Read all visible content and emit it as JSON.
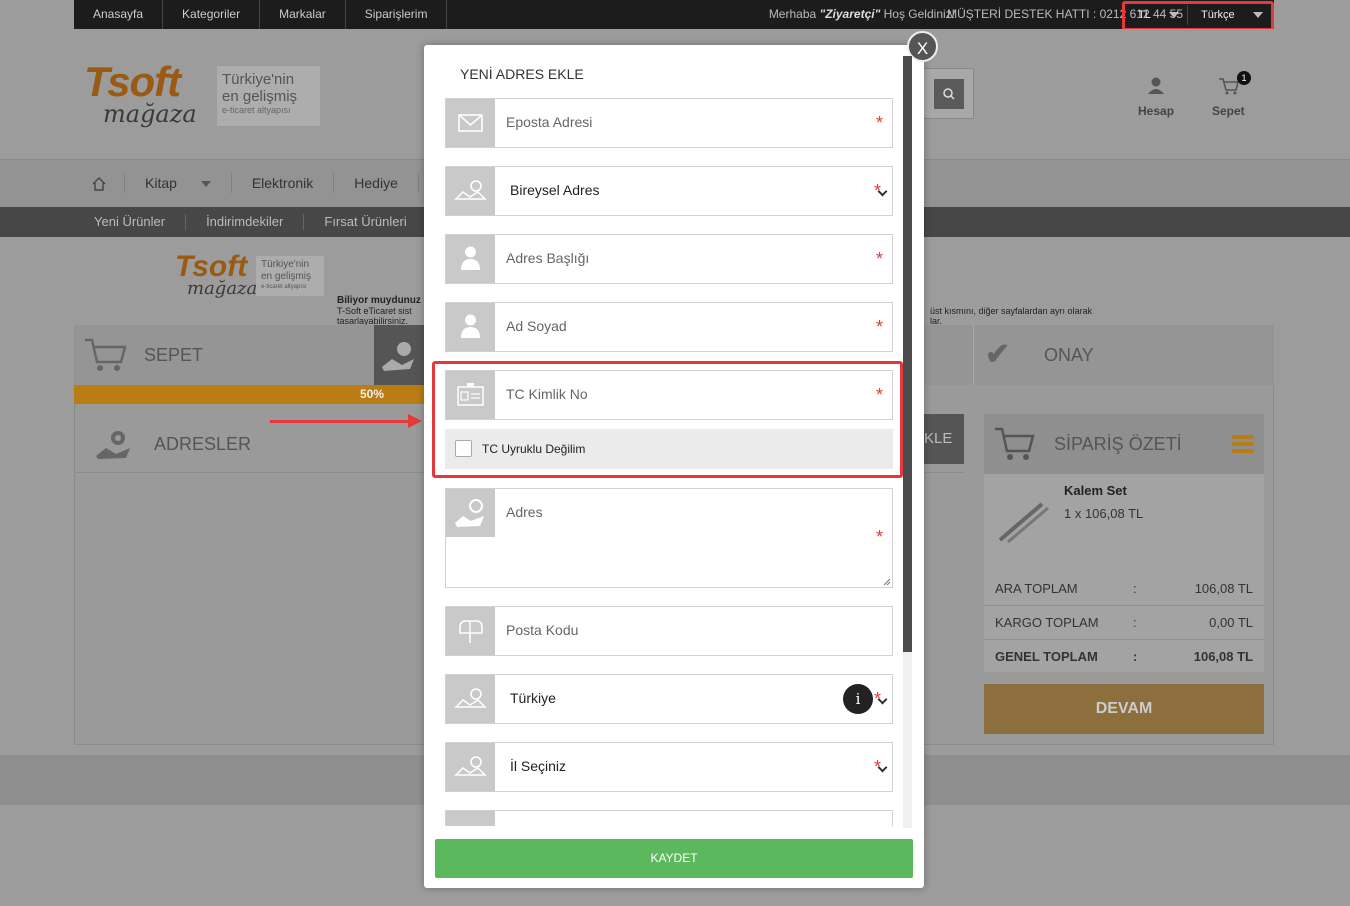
{
  "topbar": {
    "nav": [
      "Anasayfa",
      "Kategoriler",
      "Markalar",
      "Siparişlerim"
    ],
    "welcome_prefix": "Merhaba",
    "welcome_user": "\"Ziyaretçi\"",
    "welcome_suffix": "Hoş Geldiniz!",
    "hotline": "MÜŞTERİ DESTEK HATTI : 0212 612 44 55",
    "currency": "TL",
    "language": "Türkçe"
  },
  "logo": {
    "text": "Tsoft",
    "sub": "mağaza",
    "tagline1": "Türkiye'nin",
    "tagline2": "en gelişmiş",
    "tagline3": "e-ticaret altyapısı"
  },
  "header": {
    "account": "Hesap",
    "cart": "Sepet",
    "cart_count": "1"
  },
  "categories": [
    "Kitap",
    "Elektronik",
    "Hediye"
  ],
  "subnav": [
    "Yeni Ürünler",
    "İndirimdekiler",
    "Fırsat Ürünleri"
  ],
  "banner": {
    "title": "Biliyor muydunuz",
    "line1": "T-Soft eTicaret sist",
    "line2": "tasarlayabilirsiniz.",
    "right1": "üst kısmını, diğer sayfalardan ayrı olarak",
    "right2": "lar."
  },
  "steps": {
    "cart": "SEPET",
    "confirm": "ONAY",
    "progress": "50%"
  },
  "addresses": {
    "title": "ADRESLER",
    "button_frag": "KLE"
  },
  "summary": {
    "title": "SİPARİŞ ÖZETİ",
    "item_name": "Kalem Set",
    "item_qty": "1 x 106,08 TL",
    "rows": [
      {
        "label": "ARA TOPLAM",
        "sep": ":",
        "value": "106,08 TL"
      },
      {
        "label": "KARGO TOPLAM",
        "sep": ":",
        "value": "0,00 TL"
      },
      {
        "label": "GENEL TOPLAM",
        "sep": ":",
        "value": "106,08 TL"
      }
    ],
    "continue": "DEVAM"
  },
  "modal": {
    "close": "X",
    "title": "YENİ ADRES EKLE",
    "email_placeholder": "Eposta Adresi",
    "address_type": "Bireysel Adres",
    "address_title_placeholder": "Adres Başlığı",
    "name_placeholder": "Ad Soyad",
    "tc_placeholder": "TC Kimlik No",
    "tc_checkbox": "TC Uyruklu Değilim",
    "address_placeholder": "Adres",
    "postal_placeholder": "Posta Kodu",
    "country": "Türkiye",
    "city": "İl Seçiniz",
    "info": "i",
    "required_mark": "*",
    "save": "KAYDET"
  }
}
